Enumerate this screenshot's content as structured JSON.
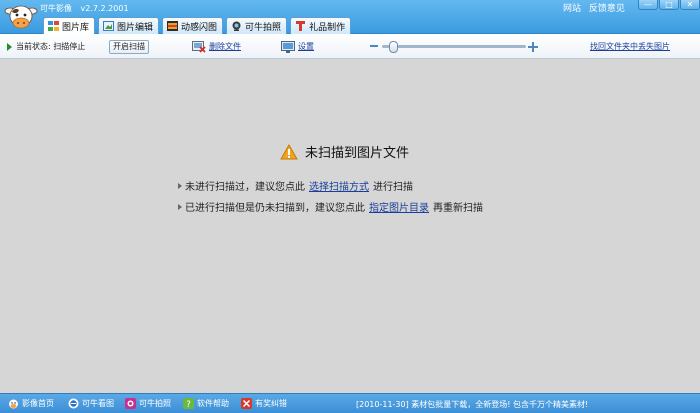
{
  "app": {
    "title": "可牛影像",
    "version": "v2.7.2.2001",
    "links": [
      "网站",
      "反馈意见"
    ],
    "window_buttons": [
      "—",
      "□",
      "✕"
    ]
  },
  "tabs": [
    {
      "label": "图片库",
      "active": true
    },
    {
      "label": "图片编辑",
      "active": false
    },
    {
      "label": "动感闪图",
      "active": false
    },
    {
      "label": "可牛拍照",
      "active": false
    },
    {
      "label": "礼品制作",
      "active": false
    }
  ],
  "toolbar": {
    "status_label": "当前状态: 扫描停止",
    "start_scan": "开启扫描",
    "delete_file": "删除文件",
    "settings": "设置",
    "find_lost": "找回文件夹中丢失图片",
    "zoom_level": 0.05
  },
  "main": {
    "title": "未扫描到图片文件",
    "line1_pre": "未进行扫描过，建议您点此",
    "line1_link": "选择扫描方式",
    "line1_post": "进行扫描",
    "line2_pre": "已进行扫描但是仍未扫描到，建议您点此",
    "line2_link": "指定图片目录",
    "line2_post": "再重新扫描"
  },
  "statusbar": {
    "items": [
      "影像首页",
      "可牛看图",
      "可牛拍照",
      "软件帮助",
      "有奖纠错"
    ],
    "news": "[2010-11-30] 素材包批量下载，全新登场! 包含千万个精美素材!"
  }
}
